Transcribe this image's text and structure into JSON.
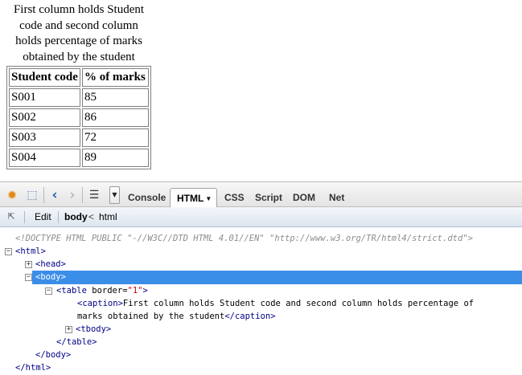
{
  "rendered_page": {
    "caption": "First column holds Student code and second column holds percentage of marks obtained by the student",
    "columns": [
      "Student code",
      "% of marks"
    ],
    "rows": [
      [
        "S001",
        "85"
      ],
      [
        "S002",
        "86"
      ],
      [
        "S003",
        "72"
      ],
      [
        "S004",
        "89"
      ]
    ]
  },
  "toolbar": {
    "tabs": [
      "Console",
      "HTML",
      "CSS",
      "Script",
      "DOM",
      "Net"
    ],
    "selected_tab": "HTML",
    "tab_arrow": "▼",
    "dropdown_arrow": "▼"
  },
  "breadcrumb": {
    "edit_label": "Edit",
    "crumbs": [
      "body",
      "html"
    ],
    "separator": "<"
  },
  "tree": {
    "doctype": "<!DOCTYPE HTML PUBLIC \"-//W3C//DTD HTML 4.01//EN\" \"http://www.w3.org/TR/html4/strict.dtd\">",
    "html_open": "<html>",
    "head": "<head>",
    "body_open": "<body>",
    "table_open_tag": "<table",
    "table_attr_name": " border=",
    "table_attr_value": "\"1\"",
    "table_open_end": ">",
    "caption_open": "<caption>",
    "caption_text_line1": "First column holds Student code and second column holds percentage of",
    "caption_text_line2": "marks obtained by the student",
    "caption_close": "</caption>",
    "tbody": "<tbody>",
    "table_close": "</table>",
    "body_close": "</body>",
    "html_close": "</html>",
    "twisty_expanded": "−",
    "twisty_collapsed": "+"
  },
  "colors": {
    "selection": "#3b8ee8",
    "tag": "#000088",
    "attr_value": "#cc0000",
    "doctype": "#8c8c8c"
  },
  "icons": {
    "firebug": "firebug-logo-icon",
    "inspect": "inspect-icon",
    "back": "back-icon",
    "forward": "forward-icon",
    "menu": "panel-menu-icon",
    "expand_collapse": "expand-collapse-icon"
  }
}
